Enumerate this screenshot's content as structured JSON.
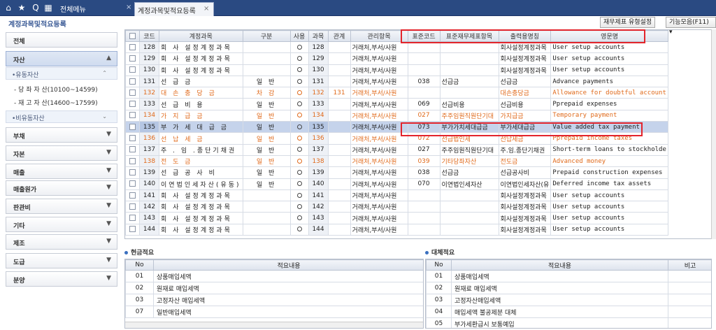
{
  "topbar": {
    "menu_label": "전체메뉴",
    "active_tab": "계정과목및적요등록"
  },
  "page_title": "계정과목및적요등록",
  "header_buttons": {
    "report_type": "재무제표 유형설정",
    "func_collection": "기능모음(F11)"
  },
  "sidebar": {
    "all": "전체",
    "assets": "자산",
    "current_assets": "•유동자산",
    "leaf1": "- 당 좌 자 산(10100~14599)",
    "leaf2": "- 재 고 자 산(14600~17599)",
    "noncurrent_assets": "•비유동자산",
    "items": [
      "부채",
      "자본",
      "매출",
      "매출원가",
      "판관비",
      "기타",
      "제조",
      "도급",
      "분양"
    ]
  },
  "grid": {
    "headers": [
      "코드",
      "계정과목",
      "구분",
      "사용",
      "과목",
      "관계",
      "관리항목",
      "표준코드",
      "표준재무제표항목",
      "출력용명칭",
      "영문명"
    ],
    "rows": [
      {
        "code": "128",
        "name": "회 사 설정계정과목",
        "gubun": "",
        "use": true,
        "gwamok": "128",
        "rel": "",
        "mgmt": "거래처,부서/사원",
        "std": "",
        "stdname": "",
        "output": "회사설정계정과목",
        "eng": "User setup accounts",
        "style": "normal"
      },
      {
        "code": "129",
        "name": "회 사 설정계정과목",
        "gubun": "",
        "use": true,
        "gwamok": "129",
        "rel": "",
        "mgmt": "거래처,부서/사원",
        "std": "",
        "stdname": "",
        "output": "회사설정계정과목",
        "eng": "User setup accounts",
        "style": "normal"
      },
      {
        "code": "130",
        "name": "회 사 설정계정과목",
        "gubun": "",
        "use": true,
        "gwamok": "130",
        "rel": "",
        "mgmt": "거래처,부서/사원",
        "std": "",
        "stdname": "",
        "output": "회사설정계정과목",
        "eng": "User setup accounts",
        "style": "normal"
      },
      {
        "code": "131",
        "name": "선 급 금",
        "gubun": "일 반",
        "use": true,
        "gwamok": "131",
        "rel": "",
        "mgmt": "거래처,부서/사원",
        "std": "038",
        "stdname": "선급금",
        "output": "선급금",
        "eng": "Advance payments",
        "style": "normal"
      },
      {
        "code": "132",
        "name": "대 손 충 당 금",
        "gubun": "차 감",
        "use": true,
        "gwamok": "132",
        "rel": "131",
        "mgmt": "거래처,부서/사원",
        "std": "",
        "stdname": "",
        "output": "대손충당금",
        "eng": "Allowance for doubtful account",
        "style": "orange"
      },
      {
        "code": "133",
        "name": "선 급 비 용",
        "gubun": "일 반",
        "use": true,
        "gwamok": "133",
        "rel": "",
        "mgmt": "거래처,부서/사원",
        "std": "069",
        "stdname": "선급비용",
        "output": "선급비용",
        "eng": "Pprepaid expenses",
        "style": "normal"
      },
      {
        "code": "134",
        "name": "가 지 급 금",
        "gubun": "일 반",
        "use": true,
        "gwamok": "134",
        "rel": "",
        "mgmt": "거래처,부서/사원",
        "std": "027",
        "stdname": "주주임원직원단기대",
        "output": "가지급금",
        "eng": "Temporary payment",
        "style": "orange"
      },
      {
        "code": "135",
        "name": "부 가 세 대 급 금",
        "gubun": "일 반",
        "use": true,
        "gwamok": "135",
        "rel": "",
        "mgmt": "거래처,부서/사원",
        "std": "073",
        "stdname": "부가가치세대급금",
        "output": "부가세대급금",
        "eng": "Value added tax payment",
        "style": "sel"
      },
      {
        "code": "136",
        "name": "선 납 세 금",
        "gubun": "일 반",
        "use": true,
        "gwamok": "136",
        "rel": "",
        "mgmt": "거래처,부서/사원",
        "std": "072",
        "stdname": "선급법인세",
        "output": "선납세금",
        "eng": "Pprepaid income taxes",
        "style": "orange"
      },
      {
        "code": "137",
        "name": "주 . 임 .종단기채권",
        "gubun": "일 반",
        "use": true,
        "gwamok": "137",
        "rel": "",
        "mgmt": "거래처,부서/사원",
        "std": "027",
        "stdname": "주주임원직원단기대",
        "output": "주.임.종단기채권",
        "eng": "Short-term loans to stockholde",
        "style": "normal"
      },
      {
        "code": "138",
        "name": "전 도 금",
        "gubun": "일 반",
        "use": true,
        "gwamok": "138",
        "rel": "",
        "mgmt": "거래처,부서/사원",
        "std": "039",
        "stdname": "기타당좌자산",
        "output": "전도금",
        "eng": "Advanced money",
        "style": "orange"
      },
      {
        "code": "139",
        "name": "선 급 공 사 비",
        "gubun": "일 반",
        "use": true,
        "gwamok": "139",
        "rel": "",
        "mgmt": "거래처,부서/사원",
        "std": "038",
        "stdname": "선급금",
        "output": "선급공사비",
        "eng": "Prepaid construction expenses",
        "style": "normal"
      },
      {
        "code": "140",
        "name": "이연법인세자산(유동)",
        "gubun": "일 반",
        "use": true,
        "gwamok": "140",
        "rel": "",
        "mgmt": "거래처,부서/사원",
        "std": "070",
        "stdname": "이연법인세자산",
        "output": "이연법인세자산(유",
        "eng": "Deferred income tax assets",
        "style": "normal"
      },
      {
        "code": "141",
        "name": "회 사 설정계정과목",
        "gubun": "",
        "use": true,
        "gwamok": "141",
        "rel": "",
        "mgmt": "거래처,부서/사원",
        "std": "",
        "stdname": "",
        "output": "회사설정계정과목",
        "eng": "User setup accounts",
        "style": "normal"
      },
      {
        "code": "142",
        "name": "회 사 설정계정과목",
        "gubun": "",
        "use": true,
        "gwamok": "142",
        "rel": "",
        "mgmt": "거래처,부서/사원",
        "std": "",
        "stdname": "",
        "output": "회사설정계정과목",
        "eng": "User setup accounts",
        "style": "normal"
      },
      {
        "code": "143",
        "name": "회 사 설정계정과목",
        "gubun": "",
        "use": true,
        "gwamok": "143",
        "rel": "",
        "mgmt": "거래처,부서/사원",
        "std": "",
        "stdname": "",
        "output": "회사설정계정과목",
        "eng": "User setup accounts",
        "style": "normal"
      },
      {
        "code": "144",
        "name": "회 사 설정계정과목",
        "gubun": "",
        "use": true,
        "gwamok": "144",
        "rel": "",
        "mgmt": "거래처,부서/사원",
        "std": "",
        "stdname": "",
        "output": "회사설정계정과목",
        "eng": "User setup accounts",
        "style": "normal"
      }
    ]
  },
  "cash_memo": {
    "title": "현금적요",
    "headers": [
      "No",
      "적요내용"
    ],
    "rows": [
      [
        "01",
        "상품매입세액"
      ],
      [
        "02",
        "원재료 매입세액"
      ],
      [
        "03",
        "고정자산 매입세액"
      ],
      [
        "07",
        "일반매입세액"
      ]
    ]
  },
  "transfer_memo": {
    "title": "대체적요",
    "headers": [
      "No",
      "적요내용",
      "비고"
    ],
    "rows": [
      [
        "01",
        "상품매입세액",
        ""
      ],
      [
        "02",
        "원재료 매입세액",
        ""
      ],
      [
        "03",
        "고정자산매입세액",
        ""
      ],
      [
        "04",
        "매입세액 불공제분 대체",
        ""
      ],
      [
        "05",
        "부가세환급시 보통예입",
        ""
      ]
    ]
  },
  "colors": {
    "accent": "#2a4a82",
    "highlight_box": "#e3252c",
    "orange_row": "#e06a1b",
    "selected_row": "#c5d3eb"
  }
}
